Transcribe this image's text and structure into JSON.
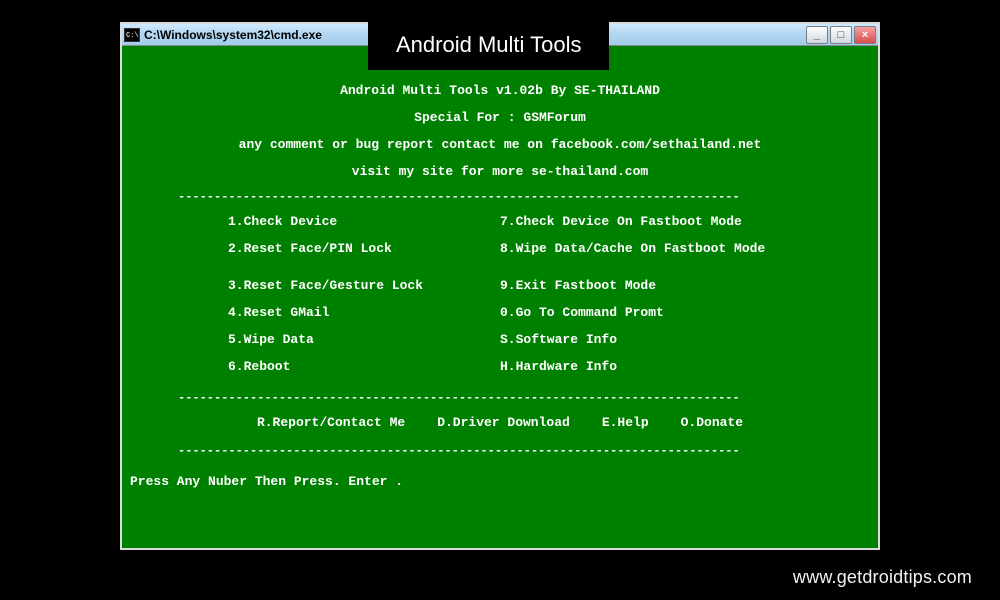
{
  "window": {
    "title": "C:\\Windows\\system32\\cmd.exe",
    "btn_min": "_",
    "btn_max": "□",
    "btn_close": "×"
  },
  "overlay": {
    "label": "Android Multi Tools"
  },
  "header": {
    "line1": "Android Multi Tools v1.02b By SE-THAILAND",
    "line2": "Special For : GSMForum",
    "line3": "any comment or bug report contact me on facebook.com/sethailand.net",
    "line4": "visit my site for more se-thailand.com"
  },
  "menu_left": [
    "1.Check Device",
    "2.Reset Face/PIN Lock",
    "",
    "3.Reset Face/Gesture Lock",
    "4.Reset GMail",
    "5.Wipe Data",
    "6.Reboot"
  ],
  "menu_right": [
    "7.Check Device On Fastboot Mode",
    "8.Wipe Data/Cache On Fastboot Mode",
    "",
    "9.Exit Fastboot Mode",
    "0.Go To Command Promt",
    "S.Software Info",
    "H.Hardware Info"
  ],
  "footer": {
    "a": "R.Report/Contact Me",
    "b": "D.Driver Download",
    "c": "E.Help",
    "d": "O.Donate"
  },
  "prompt": "Press Any Nuber Then Press. Enter  .",
  "dash": "------------------------------------------------------------------------------",
  "watermark": "www.getdroidtips.com"
}
